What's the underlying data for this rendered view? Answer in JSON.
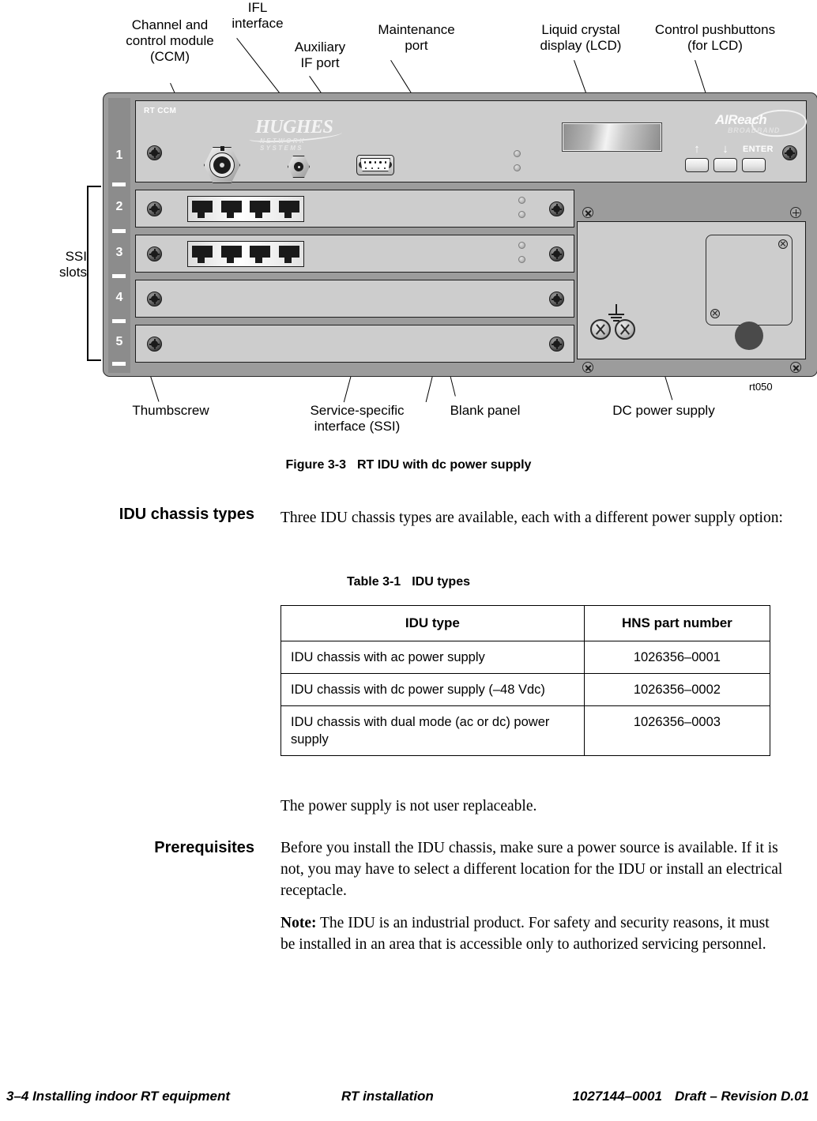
{
  "figure": {
    "caption_number": "Figure  3-3",
    "caption_text": "RT IDU with dc power supply",
    "figure_id": "rt050",
    "callouts": {
      "ccm": "Channel and\ncontrol module\n(CCM)",
      "ifl": "IFL\ninterface",
      "aux": "Auxiliary\nIF port",
      "maint": "Maintenance\nport",
      "lcd": "Liquid crystal\ndisplay (LCD)",
      "buttons": "Control pushbuttons\n(for LCD)",
      "thumbscrew": "Thumbscrew",
      "ssi": "Service-specific\ninterface (SSI)",
      "blank": "Blank panel",
      "dcpsu": "DC power supply",
      "ssi_slots": "SSI\nslots"
    },
    "chassis": {
      "ccm_label": "RT CCM",
      "hughes_logo": "HUGHES",
      "hughes_subtitle": "NETWORK SYSTEMS",
      "aireach_logo": "AIReach",
      "aireach_subtitle": "BROADBAND",
      "slot_numbers": [
        "1",
        "2",
        "3",
        "4",
        "5"
      ],
      "buttons": {
        "up": "↑",
        "down": "↓",
        "enter": "ENTER"
      }
    }
  },
  "sections": {
    "idu_chassis_types": {
      "heading": "IDU chassis types",
      "intro": "Three IDU chassis types are available, each with a different power supply option:",
      "after_table": "The power supply is not user replaceable."
    },
    "prerequisites": {
      "heading": "Prerequisites",
      "paragraph": "Before you install the IDU chassis, make sure a power source is available. If it is not, you may have to select a different location for the IDU or install an electrical receptacle.",
      "note_label": "Note:",
      "note_text": " The IDU is an industrial product. For safety and security reasons, it must be installed in an area that is accessible only to authorized servicing personnel."
    }
  },
  "table": {
    "title_number": "Table  3-1",
    "title_text": "IDU types",
    "headers": [
      "IDU type",
      "HNS part number"
    ],
    "rows": [
      {
        "type": "IDU chassis with ac power supply",
        "part": "1026356–0001"
      },
      {
        "type": "IDU chassis with dc power supply (–48 Vdc)",
        "part": "1026356–0002"
      },
      {
        "type": "IDU chassis with dual mode (ac or dc) power supply",
        "part": "1026356–0003"
      }
    ]
  },
  "footer": {
    "left": "3–4  Installing indoor RT equipment",
    "middle": "RT installation",
    "part_number": "1027144–0001",
    "revision": "Draft – Revision D.01"
  },
  "colors": {
    "chassis_frame": "#9c9c9c",
    "panel_face": "#cdcdcd",
    "rail": "#8c8c8c",
    "outline": "#1d1d1d",
    "text": "#000000"
  }
}
